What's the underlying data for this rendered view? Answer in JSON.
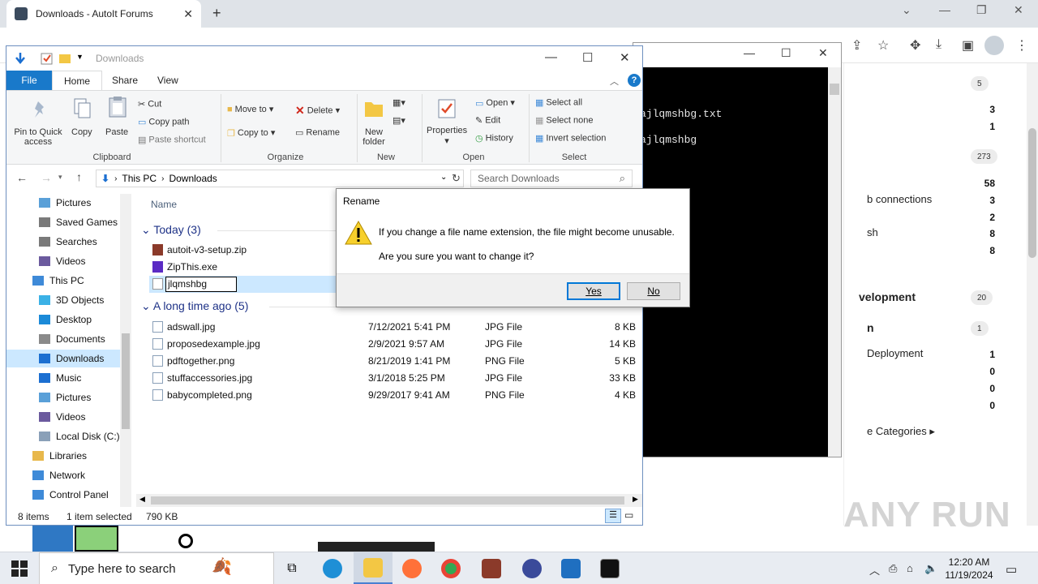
{
  "browser": {
    "tab_title": "Downloads - AutoIt Forums",
    "tab_close": "✕",
    "new_tab": "+",
    "minimize": "⌄",
    "win_min": "—",
    "win_max": "❐",
    "win_close": "✕"
  },
  "forum": {
    "rows": [
      {
        "label": "",
        "num": "5",
        "badge": true
      },
      {
        "label": "",
        "num": "3",
        "badge": false
      },
      {
        "label": "",
        "num": "1",
        "badge": false
      },
      {
        "label": "",
        "num": "273",
        "badge": true
      },
      {
        "label": "",
        "num": "58",
        "badge": false
      },
      {
        "label": "b connections",
        "num": "3",
        "badge": false
      },
      {
        "label": "",
        "num": "2",
        "badge": false
      },
      {
        "label": "sh",
        "num": "8",
        "badge": false
      },
      {
        "label": "",
        "num": "8",
        "badge": false
      },
      {
        "label": "velopment",
        "num": "20",
        "badge": true
      },
      {
        "label": "n",
        "num": "1",
        "badge": true
      },
      {
        "label": "Deployment",
        "num": "1",
        "badge": false
      },
      {
        "label": "",
        "num": "0",
        "badge": false
      },
      {
        "label": "",
        "num": "0",
        "badge": false
      },
      {
        "label": "",
        "num": "0",
        "badge": false
      }
    ],
    "categories_link": "e Categories ▸"
  },
  "console": {
    "line1": "ajlqmshbg.txt",
    "line2": "ajlqmshbg"
  },
  "explorer": {
    "title": "Downloads",
    "tabs": {
      "file": "File",
      "home": "Home",
      "share": "Share",
      "view": "View"
    },
    "ribbon": {
      "pin": "Pin to Quick access",
      "copy": "Copy",
      "paste": "Paste",
      "cut": "Cut",
      "copy_path": "Copy path",
      "paste_shortcut": "Paste shortcut",
      "clipboard": "Clipboard",
      "move_to": "Move to",
      "copy_to": "Copy to",
      "delete": "Delete",
      "rename": "Rename",
      "organize": "Organize",
      "new_folder": "New folder",
      "new": "New",
      "properties": "Properties",
      "open": "Open",
      "edit": "Edit",
      "history": "History",
      "open_group": "Open",
      "select_all": "Select all",
      "select_none": "Select none",
      "invert_selection": "Invert selection",
      "select": "Select"
    },
    "address": {
      "this_pc": "This PC",
      "folder": "Downloads"
    },
    "search_placeholder": "Search Downloads",
    "nav": [
      {
        "label": "Pictures",
        "color": "#5aa0d8",
        "indent": 40,
        "sel": false
      },
      {
        "label": "Saved Games",
        "color": "#7a7a7a",
        "indent": 40,
        "sel": false
      },
      {
        "label": "Searches",
        "color": "#7a7a7a",
        "indent": 40,
        "sel": false
      },
      {
        "label": "Videos",
        "color": "#6b5a9e",
        "indent": 40,
        "sel": false
      },
      {
        "label": "This PC",
        "color": "#3e8ad8",
        "indent": 32,
        "sel": false
      },
      {
        "label": "3D Objects",
        "color": "#3bb1e6",
        "indent": 40,
        "sel": false
      },
      {
        "label": "Desktop",
        "color": "#1b8ad8",
        "indent": 40,
        "sel": false
      },
      {
        "label": "Documents",
        "color": "#8a8a8a",
        "indent": 40,
        "sel": false
      },
      {
        "label": "Downloads",
        "color": "#1b6fd1",
        "indent": 40,
        "sel": true
      },
      {
        "label": "Music",
        "color": "#1b6fd1",
        "indent": 40,
        "sel": false
      },
      {
        "label": "Pictures",
        "color": "#5aa0d8",
        "indent": 40,
        "sel": false
      },
      {
        "label": "Videos",
        "color": "#6b5a9e",
        "indent": 40,
        "sel": false
      },
      {
        "label": "Local Disk (C:)",
        "color": "#8aa0b8",
        "indent": 40,
        "sel": false
      },
      {
        "label": "Libraries",
        "color": "#e8b84b",
        "indent": 32,
        "sel": false
      },
      {
        "label": "Network",
        "color": "#3e8ad8",
        "indent": 32,
        "sel": false
      },
      {
        "label": "Control Panel",
        "color": "#3e8ad8",
        "indent": 32,
        "sel": false
      }
    ],
    "col_name": "Name",
    "group_today": "Today (3)",
    "group_old": "A long time ago (5)",
    "today_files": [
      {
        "name": "autoit-v3-setup.zip",
        "color": "#8b3a2a"
      },
      {
        "name": "ZipThis.exe",
        "color": "#5b2bc4"
      }
    ],
    "rename_value": "jlqmshbg",
    "old_files": [
      {
        "name": "adswall.jpg",
        "date": "7/12/2021 5:41 PM",
        "type": "JPG File",
        "size": "8 KB"
      },
      {
        "name": "proposedexample.jpg",
        "date": "2/9/2021 9:57 AM",
        "type": "JPG File",
        "size": "14 KB"
      },
      {
        "name": "pdftogether.png",
        "date": "8/21/2019 1:41 PM",
        "type": "PNG File",
        "size": "5 KB"
      },
      {
        "name": "stuffaccessories.jpg",
        "date": "3/1/2018 5:25 PM",
        "type": "JPG File",
        "size": "33 KB"
      },
      {
        "name": "babycompleted.png",
        "date": "9/29/2017 9:41 AM",
        "type": "PNG File",
        "size": "4 KB"
      }
    ],
    "status": {
      "items": "8 items",
      "selected": "1 item selected",
      "size": "790 KB"
    }
  },
  "dialog": {
    "title": "Rename",
    "message1": "If you change a file name extension, the file might become unusable.",
    "message2": "Are you sure you want to change it?",
    "yes": "Yes",
    "no": "No"
  },
  "taskbar": {
    "search_placeholder": "Type here to search",
    "time": "12:20 AM",
    "date": "11/19/2024"
  },
  "watermark": "ANY RUN"
}
